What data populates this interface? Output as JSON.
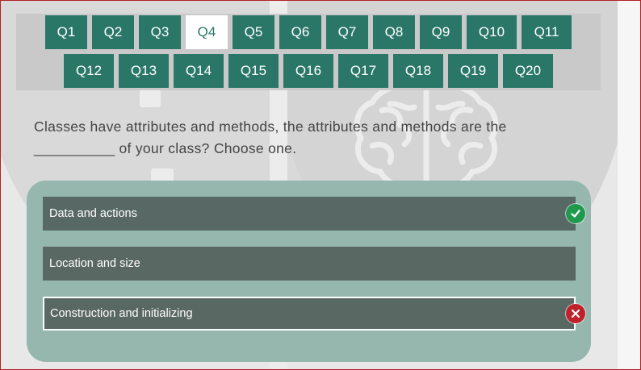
{
  "nav": {
    "row1": [
      "Q1",
      "Q2",
      "Q3",
      "Q4",
      "Q5",
      "Q6",
      "Q7",
      "Q8",
      "Q9",
      "Q10",
      "Q11"
    ],
    "row2": [
      "Q12",
      "Q13",
      "Q14",
      "Q15",
      "Q16",
      "Q17",
      "Q18",
      "Q19",
      "Q20"
    ],
    "active": "Q4"
  },
  "question": {
    "line1": "Classes have attributes and methods, the attributes and methods are the",
    "line2": "__________ of your class? Choose one."
  },
  "answers": [
    {
      "label": "Data and actions",
      "status": "correct",
      "icon": "check-icon"
    },
    {
      "label": "Location and size",
      "status": "none"
    },
    {
      "label": "Construction and initializing",
      "status": "incorrect",
      "icon": "cross-icon"
    }
  ],
  "colors": {
    "nav_button": "#2a7768",
    "nav_active_bg": "#ffffff",
    "answer_panel": "#95b7ae",
    "answer_bg": "#5a6864",
    "correct": "#1f9a4c",
    "incorrect": "#c0212b"
  }
}
